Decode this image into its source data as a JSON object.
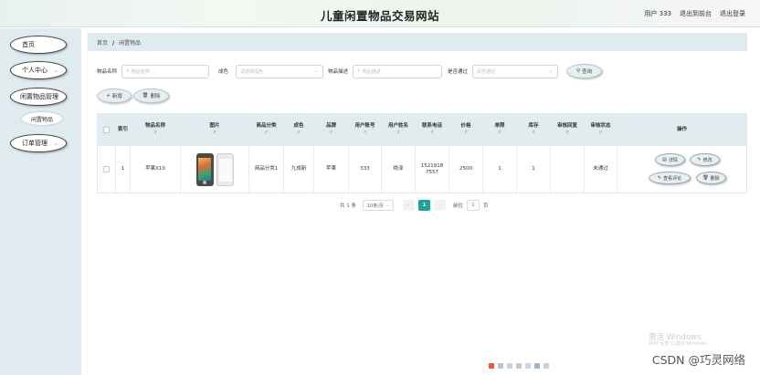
{
  "header": {
    "title": "儿童闲置物品交易网站",
    "user_label": "用户 333",
    "back_label": "退出到前台",
    "logout_label": "退出登录"
  },
  "sidebar": {
    "items": [
      {
        "label": "首页"
      },
      {
        "label": "个人中心"
      },
      {
        "label": "闲置物品管理"
      },
      {
        "label": "闲置物品"
      },
      {
        "label": "订单管理"
      }
    ]
  },
  "breadcrumb": {
    "home": "首页",
    "separator": "/",
    "current": "闲置物品"
  },
  "search": {
    "name_label": "物品名称",
    "name_placeholder": "物品名称",
    "condition_label": "成色",
    "condition_placeholder": "请选择成色",
    "desc_label": "物品描述",
    "desc_placeholder": "物品描述",
    "approved_label": "是否通过",
    "approved_placeholder": "是否通过",
    "query_button": "查询",
    "query_icon": "search-icon"
  },
  "actions": {
    "add_label": "新增",
    "add_icon": "plus-icon",
    "delete_label": "删除",
    "delete_icon": "trash-icon"
  },
  "table": {
    "headers": [
      "索引",
      "物品名称",
      "图片",
      "商品分类",
      "成色",
      "品牌",
      "用户账号",
      "用户姓名",
      "联系电话",
      "价格",
      "单限",
      "库存",
      "审核回复",
      "审核状态",
      "操作"
    ],
    "rows": [
      {
        "index": "1",
        "name": "苹果X10",
        "category": "商品分类1",
        "condition": "九成新",
        "brand": "苹果",
        "account": "333",
        "username": "绝泽",
        "phone_line1": "1521918",
        "phone_line2": "7557",
        "price": "2500",
        "limit": "1",
        "stock": "1",
        "reply": "",
        "status": "未通过"
      }
    ],
    "row_actions": {
      "detail": "详情",
      "edit": "修改",
      "reviews": "查看评论",
      "delete": "删除"
    }
  },
  "pagination": {
    "total": "共 1 条",
    "page_size": "10条/页",
    "current_page": "1",
    "goto_label": "前往",
    "goto_value": "1",
    "page_suffix": "页"
  },
  "watermark": {
    "line1": "激活 Windows",
    "line2": "转到\"设置\"以激活 Windows。"
  },
  "csdn": "CSDN @巧灵网络"
}
